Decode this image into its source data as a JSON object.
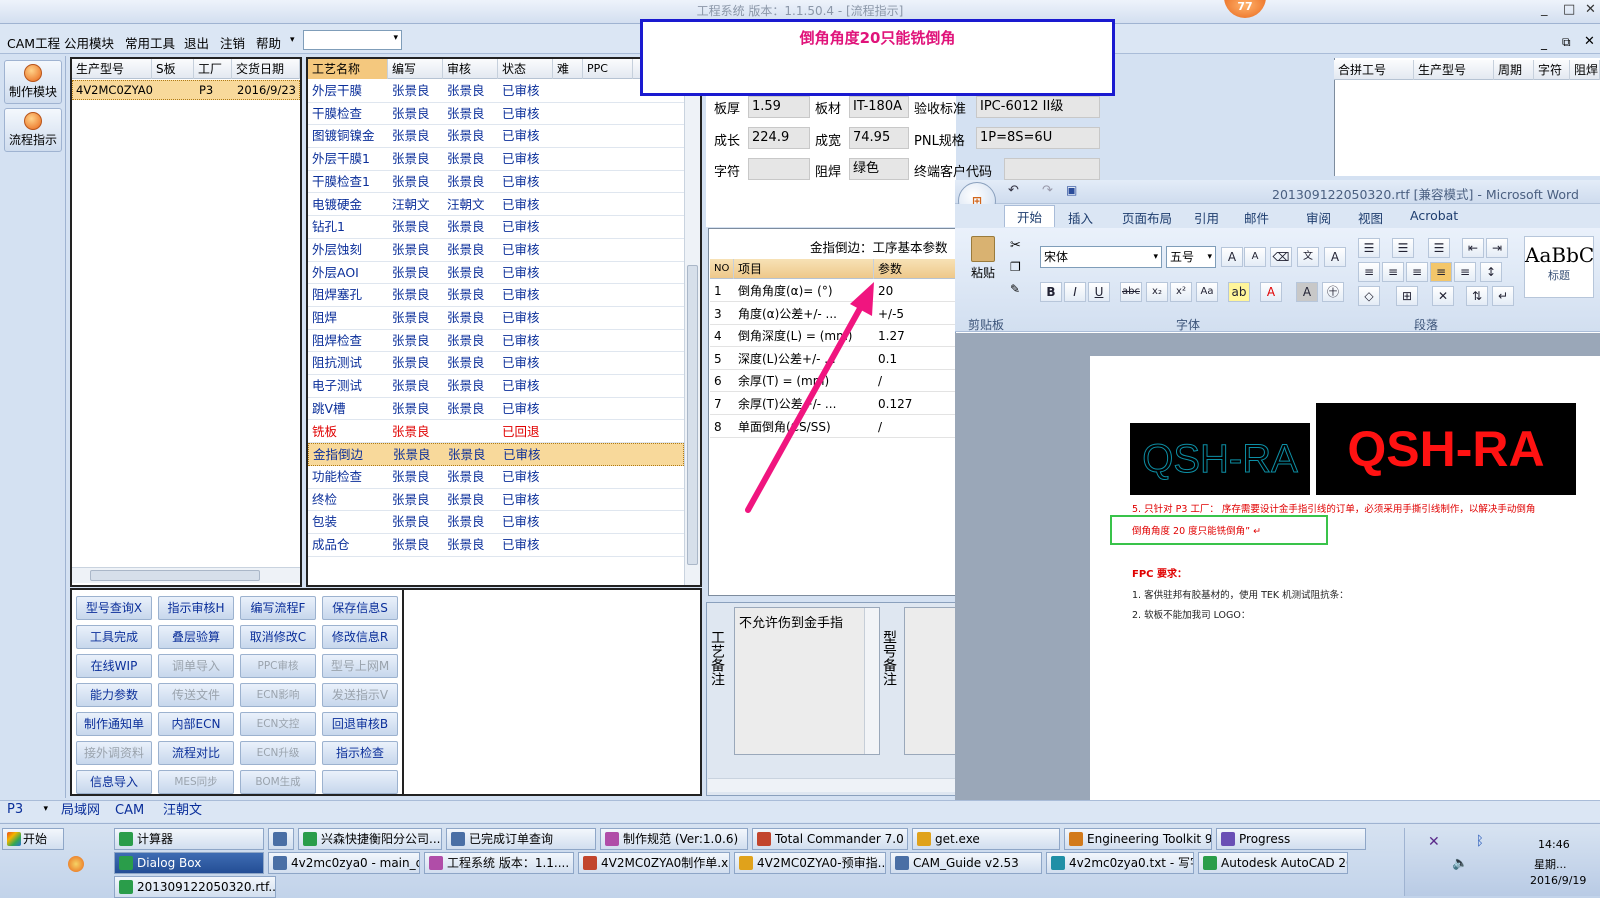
{
  "window": {
    "title": "工程系统   版本：1.1.50.4 - [流程指示]",
    "badge": "77"
  },
  "menu": {
    "items": [
      "CAM工程",
      "公用模块",
      "常用工具",
      "退出",
      "注销",
      "帮助"
    ],
    "combo_value": ""
  },
  "left_toolbar": {
    "make_label": "制作模块",
    "flow_label": "流程指示"
  },
  "orders": {
    "columns": [
      "生产型号",
      "S板",
      "工厂",
      "交货日期"
    ],
    "rows": [
      {
        "model": "4V2MC0ZYA0",
        "s": "",
        "factory": "P3",
        "date": "2016/9/23"
      }
    ]
  },
  "process": {
    "columns": [
      "工艺名称",
      "编写",
      "审核",
      "状态",
      "难",
      "PPC"
    ],
    "rows": [
      {
        "name": "外层干膜",
        "writer": "张景良",
        "reviewer": "张景良",
        "status": "已审核"
      },
      {
        "name": "干膜检查",
        "writer": "张景良",
        "reviewer": "张景良",
        "status": "已审核"
      },
      {
        "name": "图镀铜镍金",
        "writer": "张景良",
        "reviewer": "张景良",
        "status": "已审核"
      },
      {
        "name": "外层干膜1",
        "writer": "张景良",
        "reviewer": "张景良",
        "status": "已审核"
      },
      {
        "name": "干膜检查1",
        "writer": "张景良",
        "reviewer": "张景良",
        "status": "已审核"
      },
      {
        "name": "电镀硬金",
        "writer": "汪朝文",
        "reviewer": "汪朝文",
        "status": "已审核"
      },
      {
        "name": "钻孔1",
        "writer": "张景良",
        "reviewer": "张景良",
        "status": "已审核"
      },
      {
        "name": "外层蚀刻",
        "writer": "张景良",
        "reviewer": "张景良",
        "status": "已审核"
      },
      {
        "name": "外层AOI",
        "writer": "张景良",
        "reviewer": "张景良",
        "status": "已审核"
      },
      {
        "name": "阻焊塞孔",
        "writer": "张景良",
        "reviewer": "张景良",
        "status": "已审核"
      },
      {
        "name": "阻焊",
        "writer": "张景良",
        "reviewer": "张景良",
        "status": "已审核"
      },
      {
        "name": "阻焊检查",
        "writer": "张景良",
        "reviewer": "张景良",
        "status": "已审核"
      },
      {
        "name": "阻抗测试",
        "writer": "张景良",
        "reviewer": "张景良",
        "status": "已审核"
      },
      {
        "name": "电子测试",
        "writer": "张景良",
        "reviewer": "张景良",
        "status": "已审核"
      },
      {
        "name": "跳V槽",
        "writer": "张景良",
        "reviewer": "张景良",
        "status": "已审核"
      },
      {
        "name": "铣板",
        "writer": "张景良",
        "reviewer": "",
        "status": "已回退"
      },
      {
        "name": "金指倒边",
        "writer": "张景良",
        "reviewer": "张景良",
        "status": "已审核"
      },
      {
        "name": "功能检查",
        "writer": "张景良",
        "reviewer": "张景良",
        "status": "已审核"
      },
      {
        "name": "终检",
        "writer": "张景良",
        "reviewer": "张景良",
        "status": "已审核"
      },
      {
        "name": "包装",
        "writer": "张景良",
        "reviewer": "张景良",
        "status": "已审核"
      },
      {
        "name": "成品仓",
        "writer": "张景良",
        "reviewer": "张景良",
        "status": "已审核"
      }
    ]
  },
  "buttons": [
    [
      "型号查询X",
      "指示审核H",
      "编写流程F",
      "保存信息S"
    ],
    [
      "工具完成",
      "叠层验算",
      "取消修改C",
      "修改信息R"
    ],
    [
      "在线WIP",
      "调单导入",
      "PPC审核",
      "型号上网M"
    ],
    [
      "能力参数",
      "传送文件",
      "ECN影响",
      "发送指示V"
    ],
    [
      "制作通知单",
      "内部ECN",
      "ECN文控",
      "回退审核B"
    ],
    [
      "接外调资料",
      "流程对比",
      "ECN升级",
      "指示检查"
    ],
    [
      "信息导入",
      "MES同步",
      "BOM生成",
      ""
    ]
  ],
  "board_info": {
    "thickness_label": "板厚",
    "thickness": "1.59",
    "material_label": "板材",
    "material": "IT-180A",
    "standard_label": "验收标准",
    "standard": "IPC-6012 II级",
    "length_label": "成长",
    "length": "224.9",
    "width_label": "成宽",
    "width": "74.95",
    "pnl_label": "PNL规格",
    "pnl": "1P=8S=6U",
    "char_label": "字符",
    "char": "",
    "mask_label": "阻焊",
    "mask": "绿色",
    "customer_label": "终端客户代码",
    "customer": ""
  },
  "callout": {
    "text": "倒角角度20只能铣倒角"
  },
  "params": {
    "title": "金指倒边：工序基本参数",
    "columns": [
      "NO",
      "项目",
      "参数"
    ],
    "rows": [
      {
        "no": "1",
        "item": "倒角角度(α)= (°)",
        "value": "20"
      },
      {
        "no": "3",
        "item": "角度(α)公差+/- ...",
        "value": "+/-5"
      },
      {
        "no": "4",
        "item": "倒角深度(L) = (mm)",
        "value": "1.27"
      },
      {
        "no": "5",
        "item": "深度(L)公差+/- ...",
        "value": "0.1"
      },
      {
        "no": "6",
        "item": "余厚(T) = (mm)",
        "value": "/"
      },
      {
        "no": "7",
        "item": "余厚(T)公差+/- ...",
        "value": "0.127"
      },
      {
        "no": "8",
        "item": "单面倒角(CS/SS)",
        "value": "/"
      }
    ]
  },
  "notes": {
    "process_label": "工艺备注",
    "process_text": "不允许伤到金手指",
    "model_label": "型号备注"
  },
  "right_grid": {
    "columns": [
      "合拼工号",
      "生产型号",
      "周期",
      "字符",
      "阻焊"
    ]
  },
  "word": {
    "title": "201309122050320.rtf [兼容模式] - Microsoft Word",
    "tabs": [
      "开始",
      "插入",
      "页面布局",
      "引用",
      "邮件",
      "审阅",
      "视图",
      "Acrobat"
    ],
    "font_name": "宋体",
    "font_size": "五号",
    "group_clipboard": "剪贴板",
    "group_font": "字体",
    "group_para": "段落",
    "style_sample": "AaBbC",
    "style_label": "标题",
    "paste_label": "粘贴",
    "logo_left": "QSH-RA",
    "logo_right": "QSH-RA",
    "line1": "5. 只针对 P3 工厂：  序存需要设计金手指引线的订单，必须采用手撕引线制作，以解决手动倒角",
    "line2": "倒角角度 20 度只能铣倒角” ↵",
    "fpc_title": "FPC 要求：",
    "fpc1": "1. 客供驻邦有胶基材的，使用 TEK 机测试阻抗条：",
    "fpc2": "2. 软板不能加我司 LOGO：",
    "accent": "#e00000"
  },
  "statusbar": {
    "factory": "P3",
    "tabs": [
      "局域网",
      "CAM",
      "汪朝文"
    ]
  },
  "taskbar": {
    "start": "开始",
    "row1": [
      "计算器",
      "",
      "兴森快捷衡阳分公司...",
      "已完成订单查询",
      "制作规范 (Ver:1.0.6)",
      "Total Commander 7.0 ...",
      "get.exe",
      "Engineering Toolkit 9.0...",
      "Progress"
    ],
    "row2": [
      "Dialog Box",
      "4v2mc0zya0 - main_qa",
      "工程系统  版本：1.1....",
      "4V2MC0ZYA0制作单.xl...",
      "4V2MC0ZYA0-预审指...",
      "CAM_Guide v2.53",
      "4v2mc0zya0.txt - 写字板",
      "Autodesk AutoCAD 201..."
    ],
    "row3": [
      "201309122050320.rtf..."
    ],
    "time": "14:46",
    "weekday": "星期...",
    "date": "2016/9/19"
  }
}
